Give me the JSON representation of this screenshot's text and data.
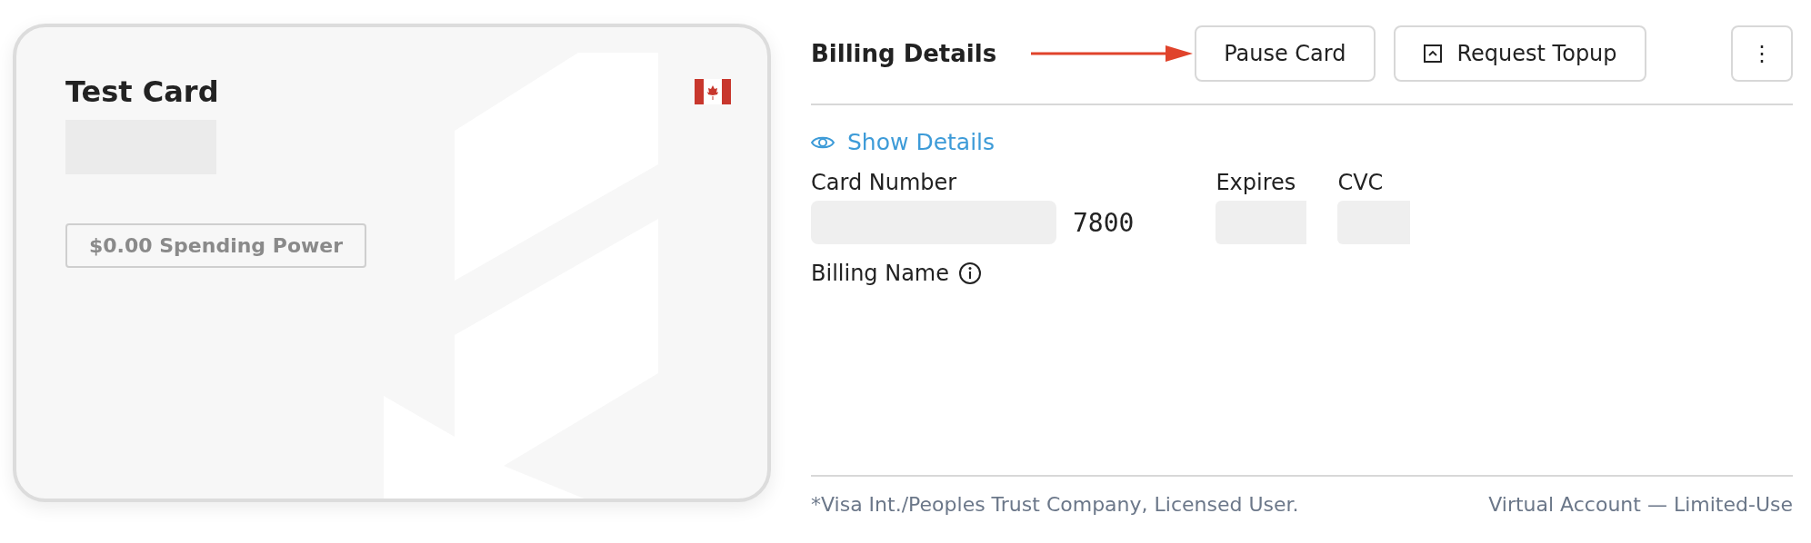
{
  "card": {
    "title": "Test Card",
    "spending_power": "$0.00 Spending Power"
  },
  "billing": {
    "title": "Billing Details",
    "buttons": [
      {
        "kind": "text",
        "label": "Pause Card"
      },
      {
        "kind": "icon-text",
        "label": "Request Topup"
      },
      {
        "kind": "more",
        "label": "⋮"
      }
    ],
    "show_details": "Show Details",
    "fields": [
      {
        "label": "Card Number",
        "value": "7800"
      },
      {
        "label": "Expires"
      },
      {
        "label": "CVC"
      }
    ],
    "billing_name": "Billing Name"
  },
  "footer": {
    "left": "*Visa Int./Peoples Trust Company, Licensed User.",
    "right": "Virtual Account — Limited-Use"
  }
}
